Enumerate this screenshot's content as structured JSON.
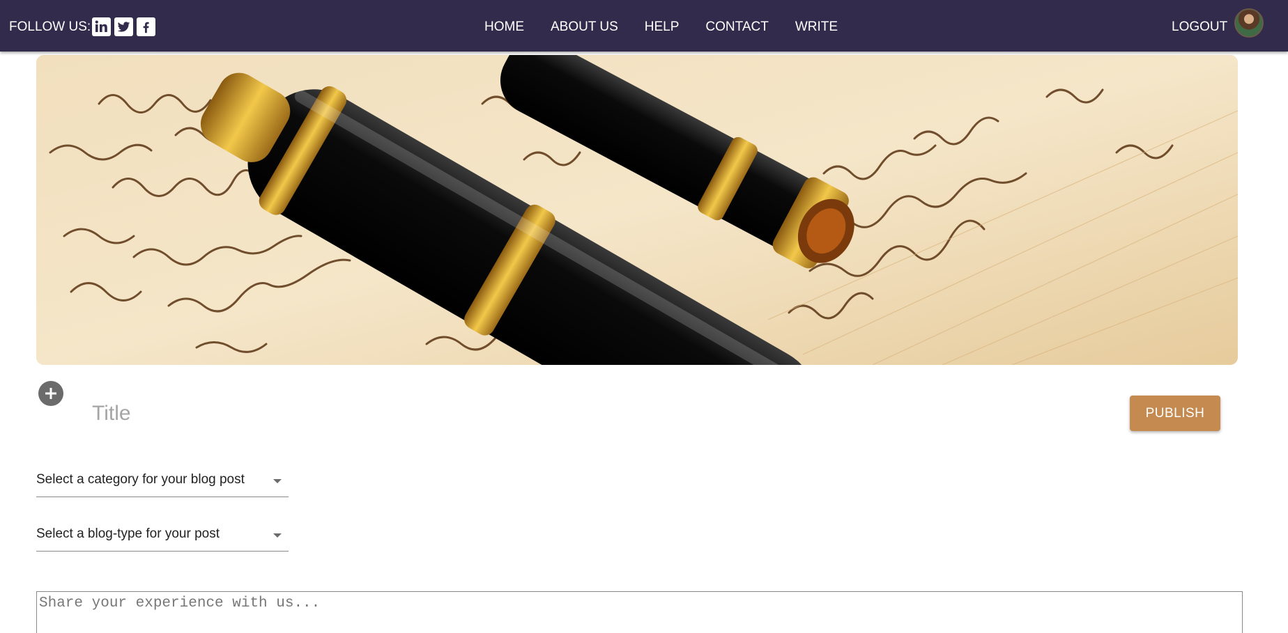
{
  "header": {
    "follow_label": "FOLLOW US:",
    "social": [
      {
        "name": "linkedin-icon"
      },
      {
        "name": "twitter-icon"
      },
      {
        "name": "facebook-icon"
      }
    ],
    "nav": [
      "HOME",
      "ABOUT US",
      "HELP",
      "CONTACT",
      "WRITE"
    ],
    "logout_label": "LOGOUT",
    "background_color": "#322b4b"
  },
  "hero": {
    "image": "fountain-pens-on-handwritten-letter"
  },
  "editor": {
    "title_placeholder": "Title",
    "publish_label": "PUBLISH",
    "publish_color": "#c58a50",
    "category_select": "Select a category for your blog post",
    "blogtype_select": "Select a blog-type for your post",
    "content_placeholder": "Share your experience with us..."
  }
}
